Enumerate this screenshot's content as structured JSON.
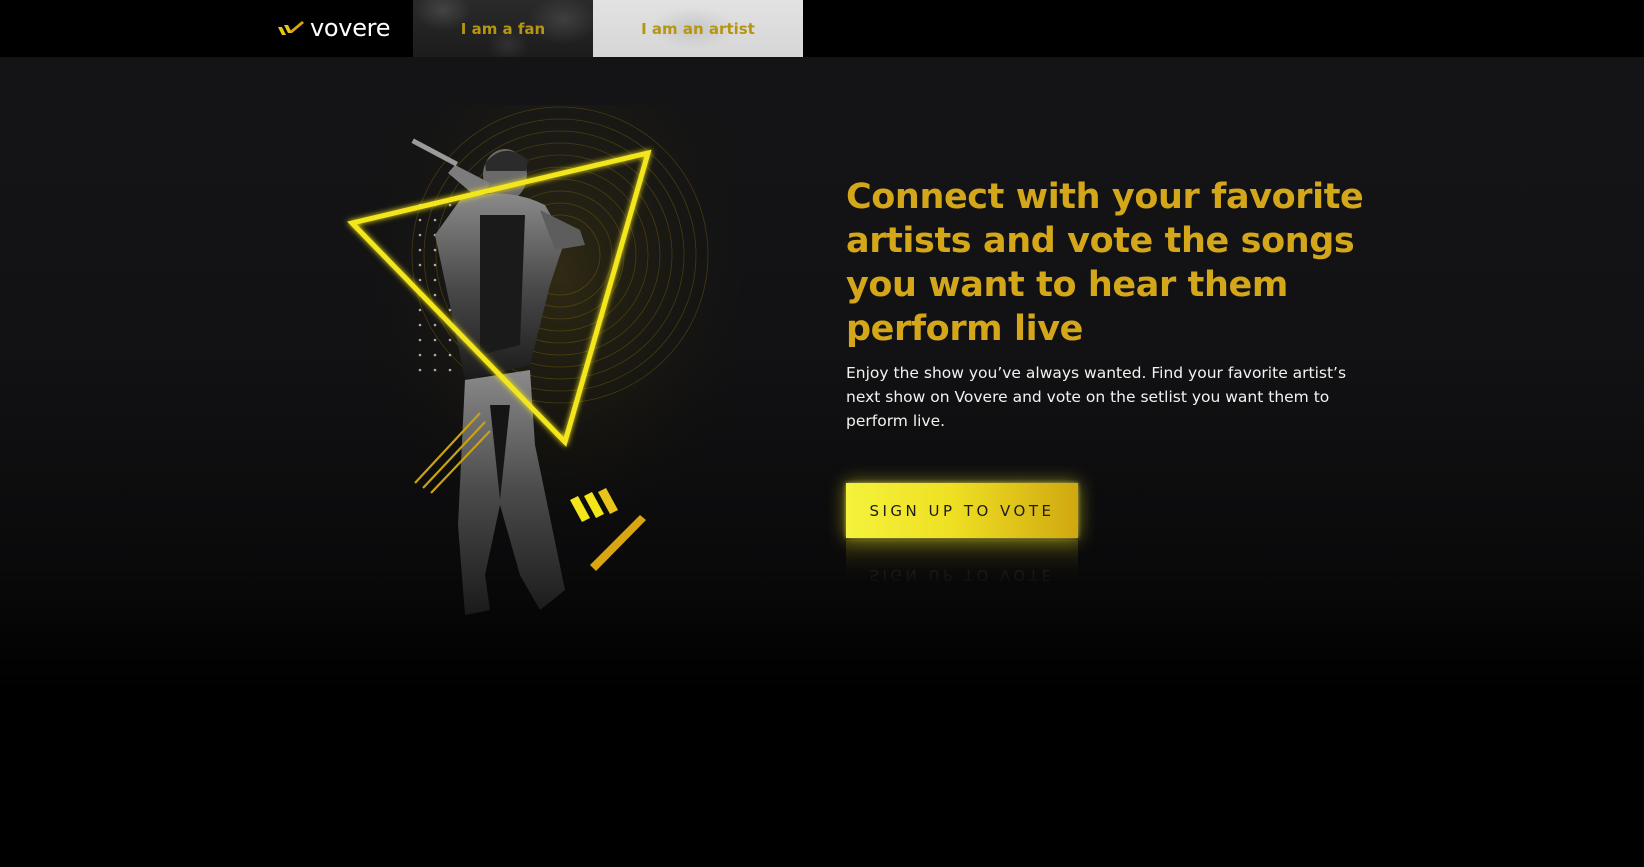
{
  "brand": {
    "name": "vovere",
    "accent": "#d4a71a",
    "highlight": "#f4f23c"
  },
  "nav": {
    "tabs": [
      {
        "label": "I am a fan"
      },
      {
        "label": "I am an artist"
      }
    ]
  },
  "hero": {
    "image_icon": "singer-with-microphone-image",
    "headline": "Connect with your favorite artists and vote the songs you want to hear them perform live",
    "subtext": "Enjoy the show you’ve always wanted. Find your favorite artist’s next show on Vovere and vote on the setlist you want them to perform live.",
    "cta_label": "SIGN UP TO VOTE"
  }
}
